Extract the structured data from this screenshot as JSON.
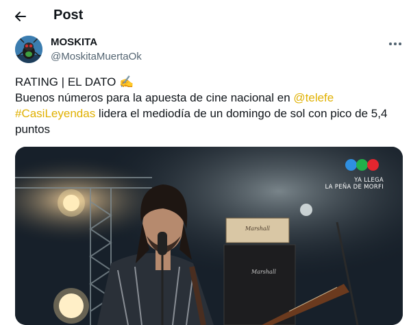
{
  "header": {
    "title": "Post",
    "back_icon": "arrow-left-icon"
  },
  "author": {
    "name": "MOSKITA",
    "handle": "@MoskitaMuertaOk",
    "avatar_icon": "mosquito-avatar"
  },
  "more_icon": "more-horizontal-icon",
  "tweet": {
    "line1": "RATING | EL DATO ✍️",
    "line2_text": "Buenos números para la apuesta de cine nacional en ",
    "mention": "@telefe",
    "hashtag": "#CasiLeyendas",
    "line3_text": " lidera el mediodía de un domingo de sol con pico de 5,4",
    "line4_text": "puntos"
  },
  "media": {
    "promo_line1": "YA LLEGA",
    "promo_line2": "LA PEÑA DE MORFI",
    "amp_brand": "Marshall",
    "amp_brand_2": "Marshall",
    "logo_colors": [
      "#2f8fe0",
      "#22b04a",
      "#e3262f"
    ]
  },
  "colors": {
    "link": "#e0b000",
    "secondary": "#536471",
    "text": "#0f1419"
  }
}
